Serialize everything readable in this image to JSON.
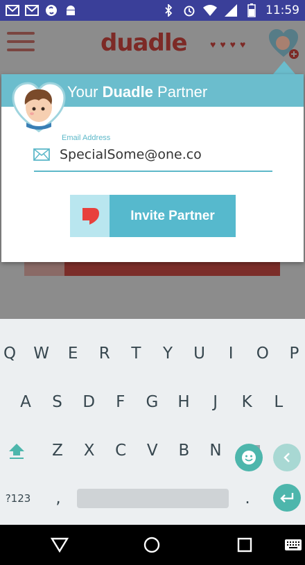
{
  "status_bar": {
    "time": "11:59",
    "icons": [
      "gmail-icon",
      "gmail-icon",
      "shazam-icon",
      "android-icon",
      "bluetooth-icon",
      "alarm-icon",
      "wifi-icon",
      "signal-icon",
      "battery-icon"
    ]
  },
  "app": {
    "logo": "duadle",
    "logo_hearts": "♥♥♥♥"
  },
  "dialog": {
    "title_prefix": "Your ",
    "title_bold": "Duadle",
    "title_suffix": " Partner",
    "email_label": "Email Address",
    "email_value": "SpecialSome@one.co",
    "invite_label": "Invite Partner"
  },
  "keyboard": {
    "row1": [
      "Q",
      "W",
      "E",
      "R",
      "T",
      "Y",
      "U",
      "I",
      "O",
      "P"
    ],
    "row2": [
      "A",
      "S",
      "D",
      "F",
      "G",
      "H",
      "J",
      "K",
      "L"
    ],
    "row3": [
      "Z",
      "X",
      "C",
      "V",
      "B",
      "N"
    ],
    "sym_key": "?123",
    "comma": ",",
    "period": "."
  },
  "colors": {
    "accent": "#56b9cd",
    "status_bar": "#3a3f99",
    "brand_red": "#e8403c",
    "keyboard_teal": "#4db6ac"
  }
}
